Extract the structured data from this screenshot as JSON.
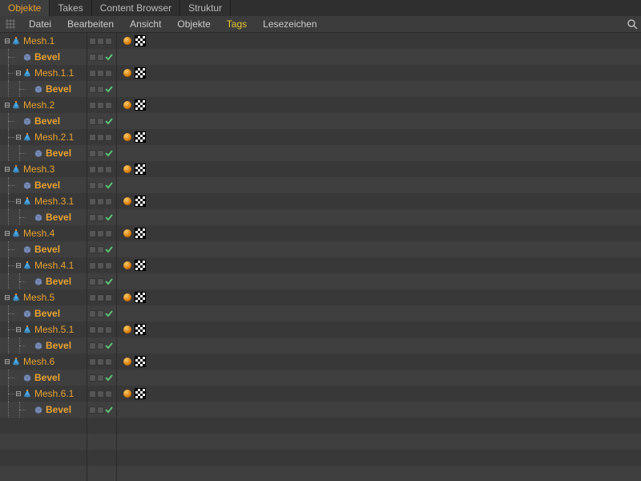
{
  "tabs": [
    "Objekte",
    "Takes",
    "Content Browser",
    "Struktur"
  ],
  "activeTab": 0,
  "menu": [
    "Datei",
    "Bearbeiten",
    "Ansicht",
    "Objekte",
    "Tags",
    "Lesezeichen"
  ],
  "activeMenu": 4,
  "tree": [
    {
      "d": 0,
      "exp": "minus",
      "icon": "cone",
      "name": "Mesh.1",
      "layer": "dots",
      "tags": "both"
    },
    {
      "d": 1,
      "exp": "none",
      "icon": "cube",
      "name": "Bevel",
      "layer": "check",
      "tags": "none",
      "last": false
    },
    {
      "d": 1,
      "exp": "minus",
      "icon": "cone",
      "name": "Mesh.1.1",
      "layer": "dots",
      "tags": "both",
      "last": true
    },
    {
      "d": 2,
      "exp": "none",
      "icon": "cube",
      "name": "Bevel",
      "layer": "check",
      "tags": "none",
      "last": true
    },
    {
      "d": 0,
      "exp": "minus",
      "icon": "cone",
      "name": "Mesh.2",
      "layer": "dots",
      "tags": "both"
    },
    {
      "d": 1,
      "exp": "none",
      "icon": "cube",
      "name": "Bevel",
      "layer": "check",
      "tags": "none",
      "last": false
    },
    {
      "d": 1,
      "exp": "minus",
      "icon": "cone",
      "name": "Mesh.2.1",
      "layer": "dots",
      "tags": "both",
      "last": true
    },
    {
      "d": 2,
      "exp": "none",
      "icon": "cube",
      "name": "Bevel",
      "layer": "check",
      "tags": "none",
      "last": true
    },
    {
      "d": 0,
      "exp": "minus",
      "icon": "cone",
      "name": "Mesh.3",
      "layer": "dots",
      "tags": "both"
    },
    {
      "d": 1,
      "exp": "none",
      "icon": "cube",
      "name": "Bevel",
      "layer": "check",
      "tags": "none",
      "last": false
    },
    {
      "d": 1,
      "exp": "minus",
      "icon": "cone",
      "name": "Mesh.3.1",
      "layer": "dots",
      "tags": "both",
      "last": true
    },
    {
      "d": 2,
      "exp": "none",
      "icon": "cube",
      "name": "Bevel",
      "layer": "check",
      "tags": "none",
      "last": true
    },
    {
      "d": 0,
      "exp": "minus",
      "icon": "cone",
      "name": "Mesh.4",
      "layer": "dots",
      "tags": "both"
    },
    {
      "d": 1,
      "exp": "none",
      "icon": "cube",
      "name": "Bevel",
      "layer": "check",
      "tags": "none",
      "last": false
    },
    {
      "d": 1,
      "exp": "minus",
      "icon": "cone",
      "name": "Mesh.4.1",
      "layer": "dots",
      "tags": "both",
      "last": true
    },
    {
      "d": 2,
      "exp": "none",
      "icon": "cube",
      "name": "Bevel",
      "layer": "check",
      "tags": "none",
      "last": true
    },
    {
      "d": 0,
      "exp": "minus",
      "icon": "cone",
      "name": "Mesh.5",
      "layer": "dots",
      "tags": "both"
    },
    {
      "d": 1,
      "exp": "none",
      "icon": "cube",
      "name": "Bevel",
      "layer": "check",
      "tags": "none",
      "last": false
    },
    {
      "d": 1,
      "exp": "minus",
      "icon": "cone",
      "name": "Mesh.5.1",
      "layer": "dots",
      "tags": "both",
      "last": true
    },
    {
      "d": 2,
      "exp": "none",
      "icon": "cube",
      "name": "Bevel",
      "layer": "check",
      "tags": "none",
      "last": true
    },
    {
      "d": 0,
      "exp": "minus",
      "icon": "cone",
      "name": "Mesh.6",
      "layer": "dots",
      "tags": "both"
    },
    {
      "d": 1,
      "exp": "none",
      "icon": "cube",
      "name": "Bevel",
      "layer": "check",
      "tags": "none",
      "last": false
    },
    {
      "d": 1,
      "exp": "minus",
      "icon": "cone",
      "name": "Mesh.6.1",
      "layer": "dots",
      "tags": "both",
      "last": true
    },
    {
      "d": 2,
      "exp": "none",
      "icon": "cube",
      "name": "Bevel",
      "layer": "check",
      "tags": "none",
      "last": true
    }
  ]
}
